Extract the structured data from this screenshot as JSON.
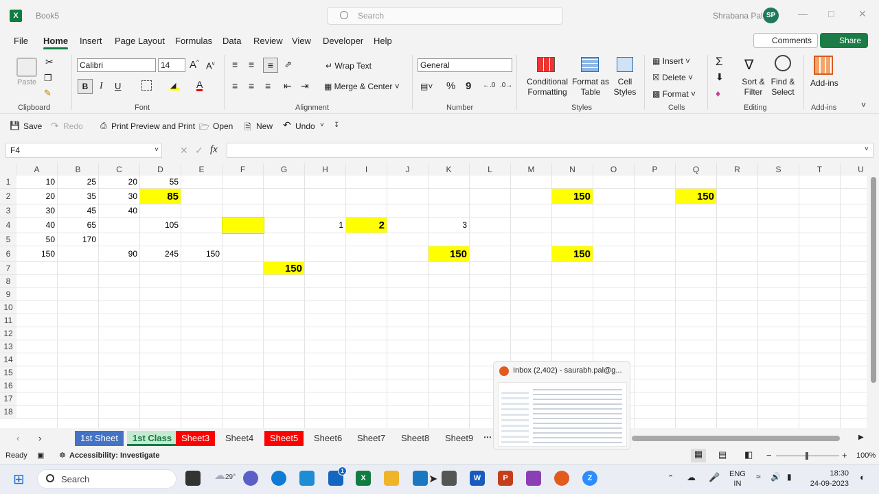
{
  "title_bar": {
    "app_icon": "X",
    "book_name": "Book5",
    "search_placeholder": "Search",
    "user_name": "Shrabana Pal",
    "user_initials": "SP"
  },
  "menu_tabs": [
    "File",
    "Home",
    "Insert",
    "Page Layout",
    "Formulas",
    "Data",
    "Review",
    "View",
    "Developer",
    "Help"
  ],
  "comments_label": "Comments",
  "share_label": "Share",
  "ribbon": {
    "clipboard": {
      "paste": "Paste",
      "group": "Clipboard"
    },
    "font": {
      "name": "Calibri",
      "size": "14",
      "bold": "B",
      "italic": "I",
      "underline": "U",
      "group": "Font"
    },
    "alignment": {
      "wrap": "Wrap Text",
      "merge": "Merge & Center",
      "group": "Alignment"
    },
    "number": {
      "format": "General",
      "percent": "%",
      "comma": "9",
      "group": "Number"
    },
    "styles": {
      "conditional": "Conditional Formatting",
      "format_table": "Format as Table",
      "cell_styles": "Cell Styles",
      "group": "Styles"
    },
    "cells": {
      "insert": "Insert",
      "delete": "Delete",
      "format": "Format",
      "group": "Cells"
    },
    "editing": {
      "sort": "Sort & Filter",
      "find": "Find & Select",
      "group": "Editing"
    },
    "addins": {
      "label": "Add-ins",
      "group": "Add-ins"
    }
  },
  "qat": [
    "Save",
    "Redo",
    "Print Preview and Print",
    "Open",
    "New",
    "Undo"
  ],
  "name_box": "F4",
  "fx_label": "fx",
  "columns": [
    "A",
    "B",
    "C",
    "D",
    "E",
    "F",
    "G",
    "H",
    "I",
    "J",
    "K",
    "L",
    "M",
    "N",
    "O",
    "P",
    "Q",
    "R",
    "S",
    "T",
    "U"
  ],
  "rows": [
    "1",
    "2",
    "3",
    "4",
    "5",
    "6",
    "7",
    "8",
    "9",
    "10",
    "11",
    "12",
    "13",
    "14",
    "15",
    "16",
    "17",
    "18"
  ],
  "cells": {
    "A1": "10",
    "B1": "25",
    "C1": "20",
    "D1": "55",
    "A2": "20",
    "B2": "35",
    "C2": "30",
    "D2": "85",
    "N2": "150",
    "Q2": "150",
    "A3": "30",
    "B3": "45",
    "C3": "40",
    "A4": "40",
    "B4": "65",
    "D4": "105",
    "H4": "1",
    "I4": "2",
    "K4": "3",
    "A5": "50",
    "B5": "170",
    "A6": "150",
    "C6": "90",
    "D6": "245",
    "E6": "150",
    "K6": "150",
    "N6": "150",
    "G7": "150"
  },
  "sheets": [
    "1st Sheet",
    "1st Class",
    "Sheet3",
    "Sheet4",
    "Sheet5",
    "Sheet6",
    "Sheet7",
    "Sheet8",
    "Sheet9"
  ],
  "status": {
    "ready": "Ready",
    "accessibility": "Accessibility: Investigate",
    "zoom": "100%"
  },
  "popup_title": "Inbox (2,402) - saurabh.pal@g...",
  "taskbar": {
    "search": "Search",
    "weather": "29°",
    "lang1": "ENG",
    "lang2": "IN",
    "time": "18:30",
    "date": "24-09-2023",
    "mail_badge": "1"
  }
}
